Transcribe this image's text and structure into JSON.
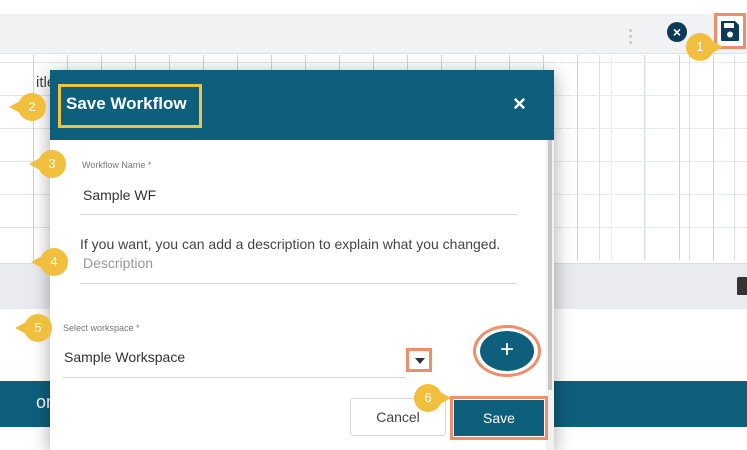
{
  "background": {
    "grid_title_fragment": "itle",
    "bottom_bar_fragment": "on",
    "close_glyph": "×"
  },
  "modal": {
    "title": "Save Workflow",
    "close_glyph": "×",
    "workflow_name_label": "Workflow Name *",
    "workflow_name_value": "Sample WF",
    "help_text": "If you want, you can add a description to explain what you changed.",
    "description_placeholder": "Description",
    "workspace_label": "Select workspace *",
    "workspace_value": "Sample Workspace",
    "add_glyph": "+",
    "cancel_label": "Cancel",
    "save_label": "Save"
  },
  "badges": [
    "1",
    "2",
    "3",
    "4",
    "5",
    "6"
  ],
  "colors": {
    "header_teal": "#0e5f7c",
    "badge_yellow": "#f2be3e",
    "highlight_orange": "#ee8f6b",
    "title_highlight": "#f0c143"
  },
  "icons": {
    "save": "floppy-disk-icon",
    "close_circle": "close-circle-icon",
    "menu": "kebab-menu-icon",
    "delete": "trash-icon",
    "dropdown": "chevron-down-icon",
    "add": "plus-icon"
  }
}
